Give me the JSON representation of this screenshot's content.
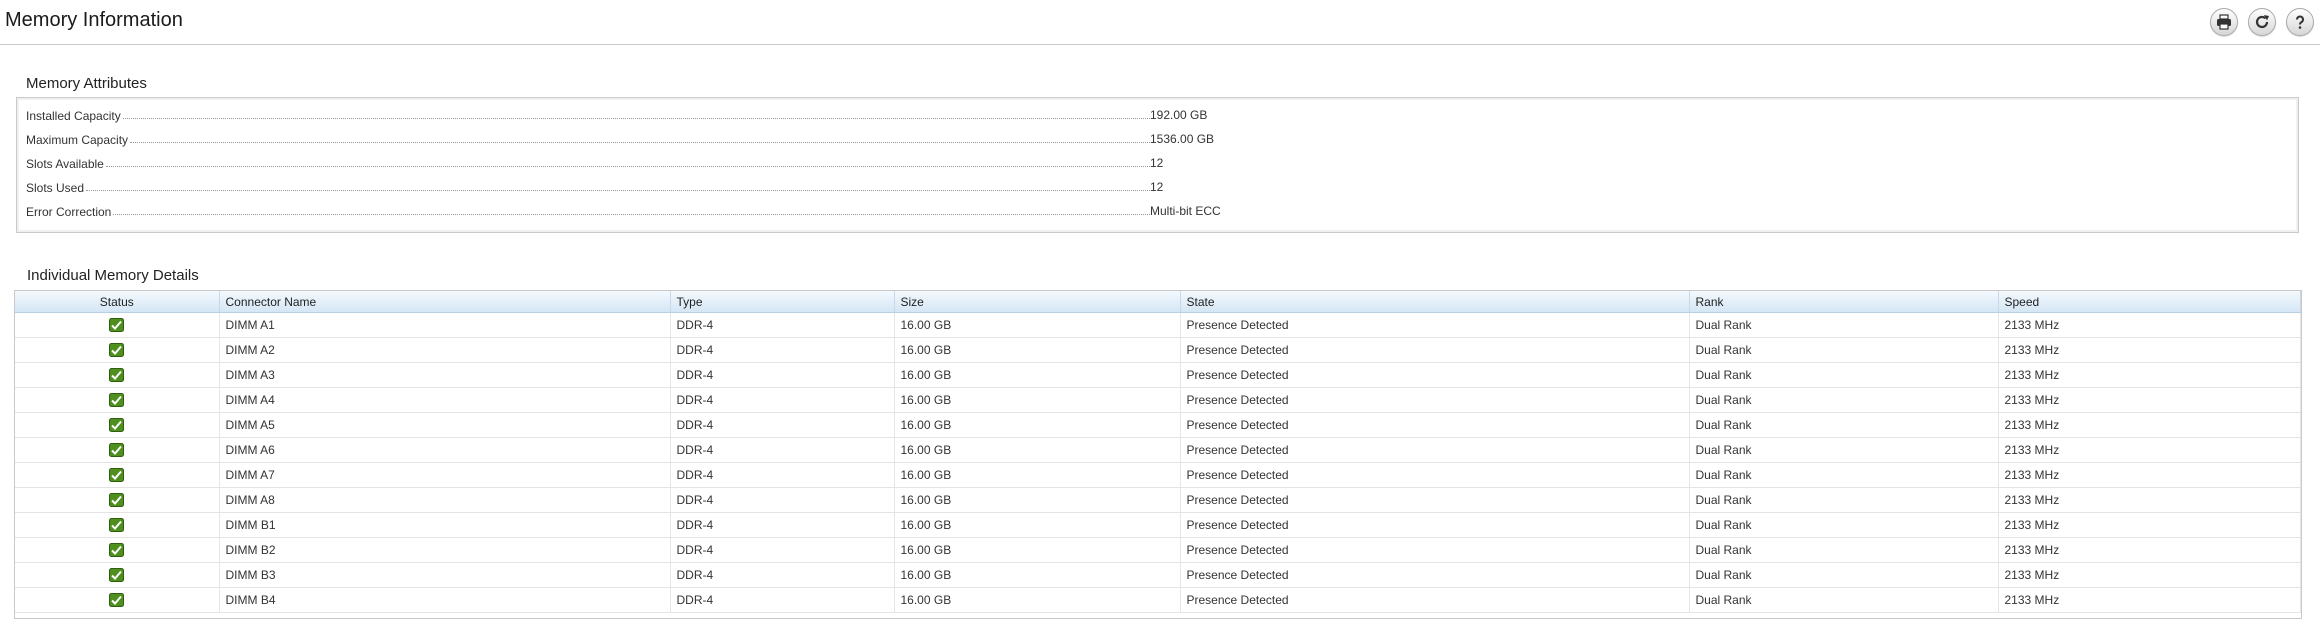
{
  "header": {
    "title": "Memory Information",
    "tools": [
      "print-icon",
      "refresh-icon",
      "help-icon"
    ]
  },
  "attributes": {
    "title": "Memory Attributes",
    "rows": [
      {
        "label": "Installed Capacity",
        "value": "192.00 GB"
      },
      {
        "label": "Maximum Capacity",
        "value": "1536.00 GB"
      },
      {
        "label": "Slots Available",
        "value": "12"
      },
      {
        "label": "Slots Used",
        "value": "12"
      },
      {
        "label": "Error Correction",
        "value": "Multi-bit ECC"
      }
    ]
  },
  "details": {
    "title": "Individual Memory Details",
    "columns": [
      "Status",
      "Connector Name",
      "Type",
      "Size",
      "State",
      "Rank",
      "Speed"
    ],
    "rows": [
      {
        "status": "ok",
        "name": "DIMM A1",
        "type": "DDR-4",
        "size": "16.00 GB",
        "state": "Presence Detected",
        "rank": "Dual Rank",
        "speed": "2133 MHz"
      },
      {
        "status": "ok",
        "name": "DIMM A2",
        "type": "DDR-4",
        "size": "16.00 GB",
        "state": "Presence Detected",
        "rank": "Dual Rank",
        "speed": "2133 MHz"
      },
      {
        "status": "ok",
        "name": "DIMM A3",
        "type": "DDR-4",
        "size": "16.00 GB",
        "state": "Presence Detected",
        "rank": "Dual Rank",
        "speed": "2133 MHz"
      },
      {
        "status": "ok",
        "name": "DIMM A4",
        "type": "DDR-4",
        "size": "16.00 GB",
        "state": "Presence Detected",
        "rank": "Dual Rank",
        "speed": "2133 MHz"
      },
      {
        "status": "ok",
        "name": "DIMM A5",
        "type": "DDR-4",
        "size": "16.00 GB",
        "state": "Presence Detected",
        "rank": "Dual Rank",
        "speed": "2133 MHz"
      },
      {
        "status": "ok",
        "name": "DIMM A6",
        "type": "DDR-4",
        "size": "16.00 GB",
        "state": "Presence Detected",
        "rank": "Dual Rank",
        "speed": "2133 MHz"
      },
      {
        "status": "ok",
        "name": "DIMM A7",
        "type": "DDR-4",
        "size": "16.00 GB",
        "state": "Presence Detected",
        "rank": "Dual Rank",
        "speed": "2133 MHz"
      },
      {
        "status": "ok",
        "name": "DIMM A8",
        "type": "DDR-4",
        "size": "16.00 GB",
        "state": "Presence Detected",
        "rank": "Dual Rank",
        "speed": "2133 MHz"
      },
      {
        "status": "ok",
        "name": "DIMM B1",
        "type": "DDR-4",
        "size": "16.00 GB",
        "state": "Presence Detected",
        "rank": "Dual Rank",
        "speed": "2133 MHz"
      },
      {
        "status": "ok",
        "name": "DIMM B2",
        "type": "DDR-4",
        "size": "16.00 GB",
        "state": "Presence Detected",
        "rank": "Dual Rank",
        "speed": "2133 MHz"
      },
      {
        "status": "ok",
        "name": "DIMM B3",
        "type": "DDR-4",
        "size": "16.00 GB",
        "state": "Presence Detected",
        "rank": "Dual Rank",
        "speed": "2133 MHz"
      },
      {
        "status": "ok",
        "name": "DIMM B4",
        "type": "DDR-4",
        "size": "16.00 GB",
        "state": "Presence Detected",
        "rank": "Dual Rank",
        "speed": "2133 MHz"
      }
    ]
  },
  "colors": {
    "status_ok": "#4e8f1e",
    "header_gradient_top": "#f4f9fd",
    "header_gradient_bottom": "#d4e6f5"
  }
}
